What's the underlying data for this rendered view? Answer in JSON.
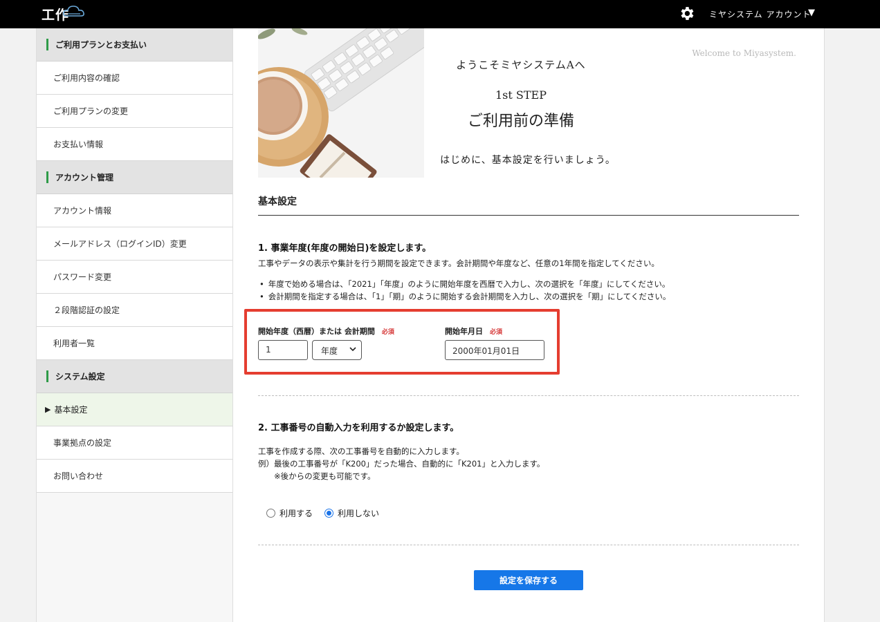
{
  "header": {
    "logo_text": "工作",
    "account_label": "ミヤシステム アカウント",
    "caret": "▼"
  },
  "sidebar": {
    "sections": [
      {
        "title": "ご利用プランとお支払い",
        "items": [
          "ご利用内容の確認",
          "ご利用プランの変更",
          "お支払い情報"
        ]
      },
      {
        "title": "アカウント管理",
        "items": [
          "アカウント情報",
          "メールアドレス（ログインID）変更",
          "パスワード変更",
          "２段階認証の設定",
          "利用者一覧"
        ]
      },
      {
        "title": "システム設定",
        "items": [
          "基本設定",
          "事業拠点の設定",
          "お問い合わせ"
        ]
      }
    ],
    "active_marker": "▶"
  },
  "hero": {
    "welcome": "Welcome to Miyasystem.",
    "line1": "ようこそミヤシステムAへ",
    "line2": "1st STEP",
    "line3": "ご利用前の準備",
    "line4": "はじめに、基本設定を行いましょう。"
  },
  "main": {
    "title": "基本設定",
    "q1": {
      "title": "1. 事業年度(年度の開始日)を設定します。",
      "desc": "工事やデータの表示や集計を行う期間を設定できます。会計期間や年度など、任意の1年間を指定してください。",
      "bullets": [
        "年度で始める場合は、「2021」「年度」のように開始年度を西暦で入力し、次の選択を「年度」にしてください。",
        "会計期間を指定する場合は、「1」「期」のように開始する会計期間を入力し、次の選択を「期」にしてください。"
      ],
      "label_start_year": "開始年度（西暦）または 会計期間",
      "label_start_date": "開始年月日",
      "required": "必須",
      "year_value": "1",
      "select_value": "年度",
      "date_value": "2000年01月01日"
    },
    "q2": {
      "title": "2. 工事番号の自動入力を利用するか設定します。",
      "desc1": "工事を作成する際、次の工事番号を自動的に入力します。",
      "desc2": "例）最後の工事番号が「K200」だった場合、自動的に「K201」と入力します。",
      "desc3": "※後からの変更も可能です。",
      "option_use": "利用する",
      "option_not_use": "利用しない",
      "selected": "利用しない"
    },
    "save_label": "設定を保存する"
  }
}
